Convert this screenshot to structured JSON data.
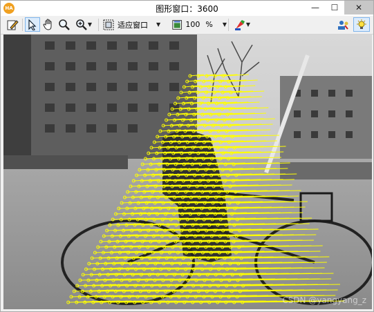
{
  "window": {
    "logo_text": "HA",
    "title": "图形窗口：3600",
    "min_glyph": "—",
    "max_glyph": "☐",
    "close_glyph": "✕"
  },
  "toolbar": {
    "fit_label": "适应窗口",
    "zoom_value": "100",
    "zoom_unit": "%"
  },
  "viewport": {
    "watermark": "CSDN @yangyang_z",
    "flow_color": "#ffff00",
    "icons": [
      "edit-icon",
      "pointer-icon",
      "hand-icon",
      "zoom-icon",
      "zoom-plus-icon",
      "fit-window-icon",
      "zoom-window-icon",
      "color-icon",
      "settings-icon",
      "light-icon"
    ]
  }
}
